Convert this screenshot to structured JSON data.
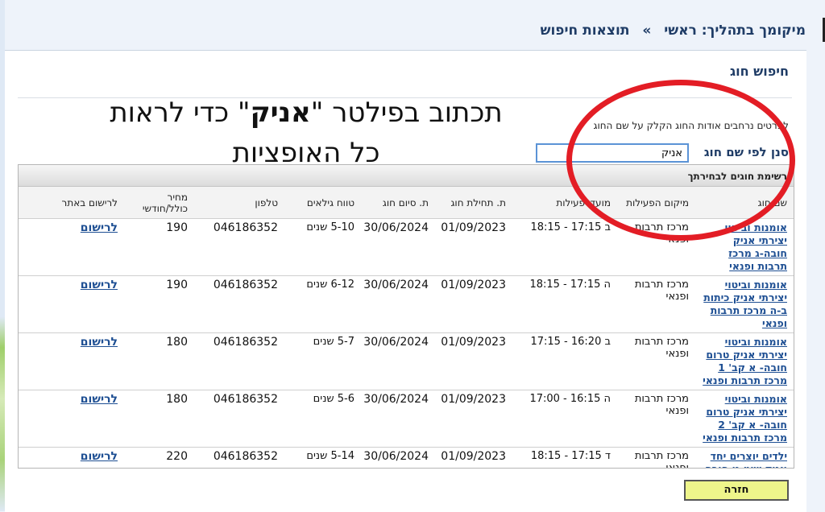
{
  "breadcrumb": {
    "current": "מיקומך בתהליך: ראשי",
    "separator": "»",
    "page": "תוצאות חיפוש"
  },
  "section_title": "חיפוש חוג",
  "info_text": "לפרטים נרחבים אודות החוג הקלק על שם החוג",
  "filter": {
    "label": "סנן לפי שם חוג",
    "value": "אניק"
  },
  "overlay": {
    "line1_before": "תכתוב בפילטר \"",
    "line1_bold": "אניק",
    "line1_after": "\" כדי לראות",
    "line2": "כל האופציות"
  },
  "list_title": "רשימת חוגים לבחירתך",
  "columns": [
    "שם חוג",
    "מיקום הפעילות",
    "מועדי פעילות",
    "ת. תחילת חוג",
    "ת. סיום חוג",
    "טווח גילאים",
    "טלפון",
    "מחיר כולל/חודשי",
    "לרישום באתר"
  ],
  "rows": [
    {
      "name": "אומנות וביטוי יצירתי אניק חובה-ג מרכז תרבות ופנאי",
      "location": "מרכז תרבות ופנאי",
      "schedule": "ב 17:15 - 18:15",
      "start": "01/09/2023",
      "end": "30/06/2024",
      "ages": "5-10 שנים",
      "phone": "046186352",
      "price": "190",
      "register": "לרישום"
    },
    {
      "name": "אומנות וביטוי יצירתי אניק כיתות ב-ה מרכז תרבות ופנאי",
      "location": "מרכז תרבות ופנאי",
      "schedule": "ה 17:15 - 18:15",
      "start": "01/09/2023",
      "end": "30/06/2024",
      "ages": "6-12 שנים",
      "phone": "046186352",
      "price": "190",
      "register": "לרישום"
    },
    {
      "name": "אומנות וביטוי יצירתי אניק טרום חובה- א קב' 1 מרכז תרבות ופנאי",
      "location": "מרכז תרבות ופנאי",
      "schedule": "ב 16:20 - 17:15",
      "start": "01/09/2023",
      "end": "30/06/2024",
      "ages": "5-7 שנים",
      "phone": "046186352",
      "price": "180",
      "register": "לרישום"
    },
    {
      "name": "אומנות וביטוי יצירתי אניק טרום חובה- א קב' 2 מרכז תרבות ופנאי",
      "location": "מרכז תרבות ופנאי",
      "schedule": "ה 16:15 - 17:00",
      "start": "01/09/2023",
      "end": "30/06/2024",
      "ages": "5-6 שנים",
      "phone": "046186352",
      "price": "180",
      "register": "לרישום"
    },
    {
      "name": "ילדים יוצרים יחד אניק שוט גן חובה מרכז תרבות ופנאי",
      "location": "מרכז תרבות ופנאי",
      "schedule": "ד 17:15 - 18:15",
      "start": "01/09/2023",
      "end": "30/06/2024",
      "ages": "5-14 שנים",
      "phone": "046186352",
      "price": "220",
      "register": "לרישום"
    }
  ],
  "back_button": "חזרה",
  "colors": {
    "accent": "#1f3c66",
    "link": "#1e4f93",
    "highlight_circle": "#e31d25",
    "back_button_bg": "#eef58b"
  }
}
